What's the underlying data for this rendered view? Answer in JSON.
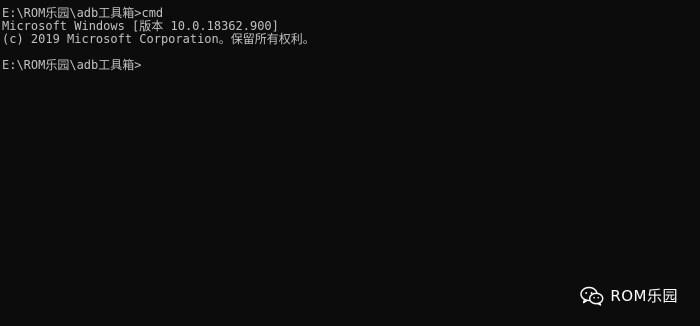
{
  "console": {
    "lines": [
      "E:\\ROM乐园\\adb工具箱>cmd",
      "Microsoft Windows [版本 10.0.18362.900]",
      "(c) 2019 Microsoft Corporation。保留所有权利。",
      "",
      "E:\\ROM乐园\\adb工具箱>"
    ],
    "text_color": "#c0c0c0",
    "background_color": "#0c0c0c"
  },
  "watermark": {
    "icon": "wechat-icon",
    "text": "ROM乐园"
  }
}
